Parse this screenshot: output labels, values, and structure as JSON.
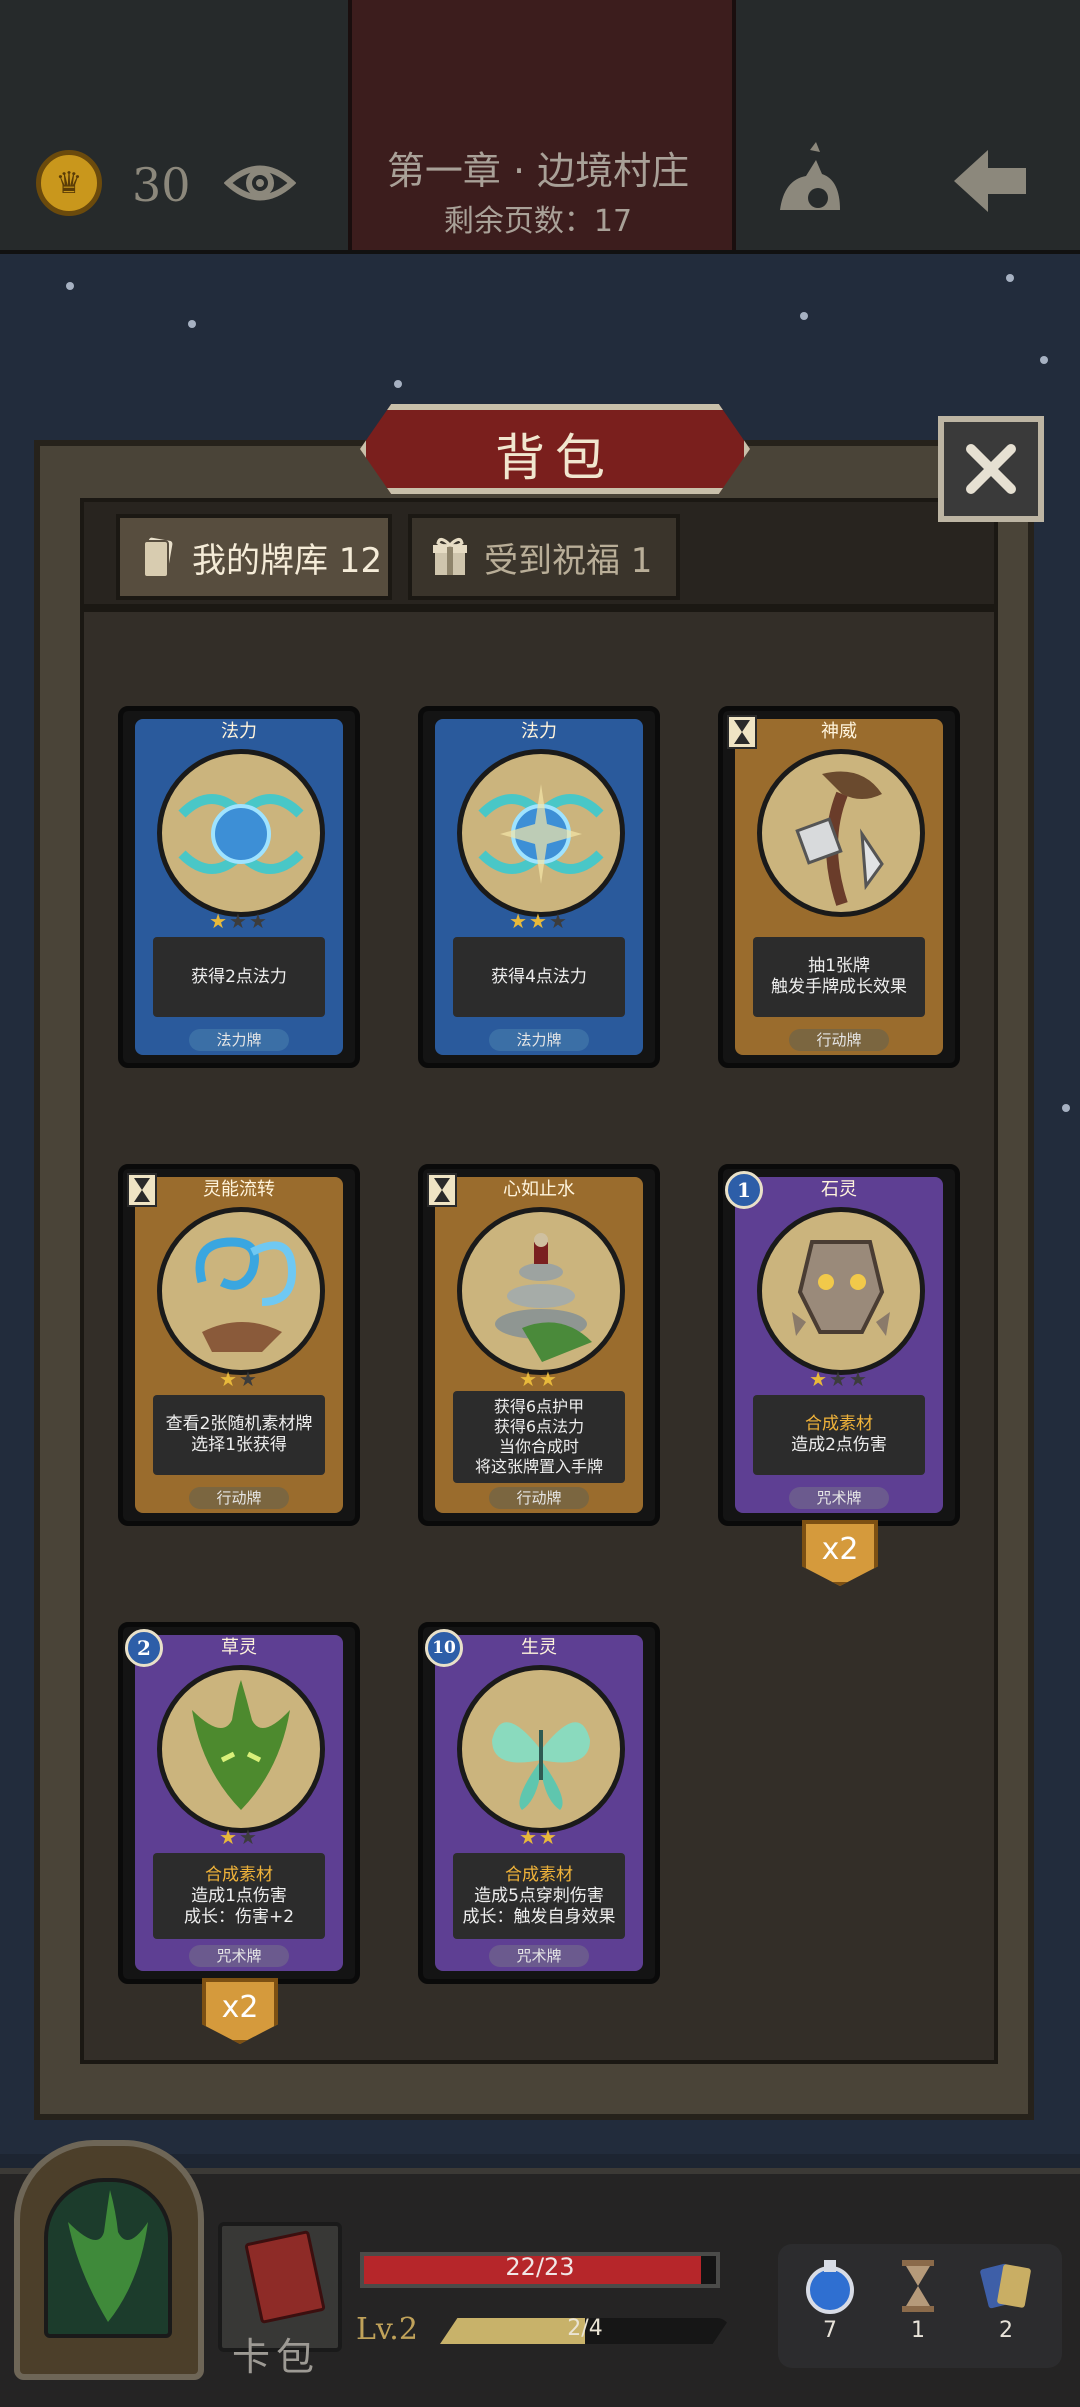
{
  "header": {
    "coins": "30",
    "chapter": "第一章 · 边境村庄",
    "pages_left": "剩余页数：17"
  },
  "dialog": {
    "title": "背包",
    "tabs": [
      {
        "label": "我的牌库 12",
        "active": true
      },
      {
        "label": "受到祝福 1",
        "active": false
      }
    ]
  },
  "cards": [
    {
      "name": "法力",
      "stars": 1,
      "max_stars": 3,
      "desc": [
        "获得2点法力"
      ],
      "type": "法力牌",
      "theme": "blue"
    },
    {
      "name": "法力",
      "stars": 2,
      "max_stars": 3,
      "desc": [
        "获得4点法力"
      ],
      "type": "法力牌",
      "theme": "blue"
    },
    {
      "name": "神威",
      "stars": 0,
      "max_stars": 0,
      "desc": [
        "抽1张牌",
        "触发手牌成长效果"
      ],
      "type": "行动牌",
      "theme": "gold",
      "icon": "hourglass-icon"
    },
    {
      "name": "灵能流转",
      "stars": 1,
      "max_stars": 2,
      "desc": [
        "查看2张随机素材牌",
        "选择1张获得"
      ],
      "type": "行动牌",
      "theme": "gold",
      "icon": "hourglass-icon"
    },
    {
      "name": "心如止水",
      "stars": 2,
      "max_stars": 2,
      "desc": [
        "获得6点护甲",
        "获得6点法力",
        "当你合成时",
        "将这张牌置入手牌"
      ],
      "type": "行动牌",
      "theme": "gold",
      "icon": "hourglass-icon"
    },
    {
      "name": "石灵",
      "stars": 1,
      "max_stars": 3,
      "desc": [
        "合成素材",
        "造成2点伤害"
      ],
      "type": "咒术牌",
      "theme": "purple",
      "cost": "1",
      "count": "x2"
    },
    {
      "name": "草灵",
      "stars": 1,
      "max_stars": 2,
      "desc": [
        "合成素材",
        "造成1点伤害",
        "成长：伤害+2"
      ],
      "type": "咒术牌",
      "theme": "purple",
      "cost": "2",
      "count": "x2"
    },
    {
      "name": "生灵",
      "stars": 2,
      "max_stars": 2,
      "desc": [
        "合成素材",
        "造成5点穿刺伤害",
        "成长：触发自身效果"
      ],
      "type": "咒术牌",
      "theme": "purple",
      "cost": "10"
    }
  ],
  "player": {
    "deck_label": "卡包",
    "hp_text": "22/23",
    "hp_ratio": 0.9565,
    "level": "Lv.2",
    "xp_text": "2/4",
    "xp_ratio": 0.5
  },
  "inventory": [
    {
      "icon": "potion-icon",
      "count": "7"
    },
    {
      "icon": "hourglass-icon",
      "count": "1"
    },
    {
      "icon": "cards-icon",
      "count": "2"
    }
  ],
  "colors": {
    "accent_red": "#7a1f1d",
    "hp_red": "#b6262a",
    "gold": "#c9971c",
    "highlight": "#f0b33a"
  }
}
